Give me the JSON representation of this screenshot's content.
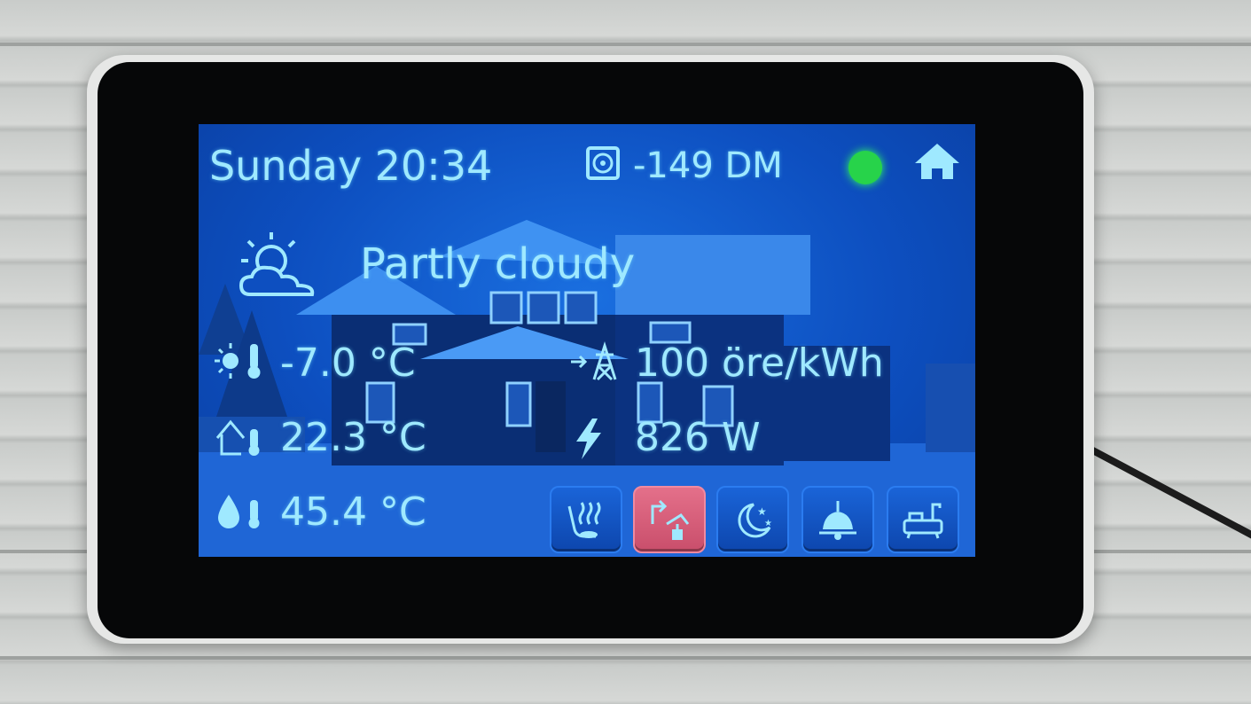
{
  "header": {
    "datetime": "Sunday 20:34",
    "meter_value": "-149 DM"
  },
  "weather": {
    "condition": "Partly cloudy"
  },
  "readings": {
    "outdoor_temp": "-7.0 °C",
    "indoor_temp": "22.3 °C",
    "water_temp": "45.4 °C",
    "electricity_price": "100 öre/kWh",
    "power_usage": "826 W"
  },
  "status": {
    "indicator_color": "#27d34a"
  },
  "buttons": [
    {
      "icon": "sauna-heat-icon",
      "active": false
    },
    {
      "icon": "faucet-icon",
      "active": true
    },
    {
      "icon": "night-moon-icon",
      "active": false
    },
    {
      "icon": "ceiling-lamp-icon",
      "active": false
    },
    {
      "icon": "bathtub-icon",
      "active": false
    }
  ],
  "colors": {
    "screen_bg": "#0d4fc0",
    "text": "#9fe9ff",
    "active_button": "#c94e6b"
  }
}
